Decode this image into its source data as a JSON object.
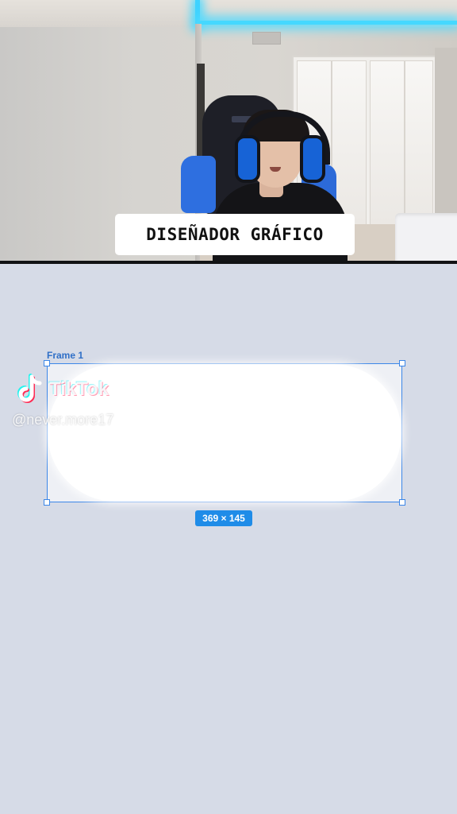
{
  "webcam": {
    "caption": "DISEÑADOR GRÁFICO"
  },
  "canvas": {
    "frame_label": "Frame 1",
    "dimensions": "369 × 145",
    "selection_color": "#3b86e8",
    "badge_color": "#1f8ce8"
  },
  "watermark": {
    "brand": "TikTok",
    "handle": "@never.more17"
  }
}
